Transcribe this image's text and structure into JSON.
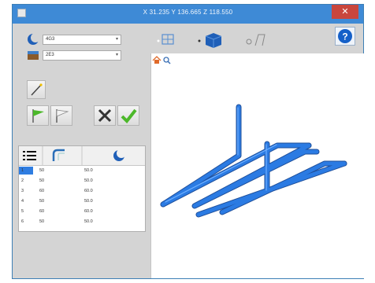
{
  "window": {
    "title": "X 31.235  Y 136.665  Z 118.550",
    "close_glyph": "✕"
  },
  "left_panel": {
    "dropdown1": {
      "value": "4G3"
    },
    "dropdown2": {
      "value": "2E3"
    }
  },
  "grid": {
    "rows": [
      {
        "c1": "1",
        "c2": "50",
        "c3": "50.0"
      },
      {
        "c1": "2",
        "c2": "50",
        "c3": "50.0"
      },
      {
        "c1": "3",
        "c2": "60",
        "c3": "60.0"
      },
      {
        "c1": "4",
        "c2": "50",
        "c3": "50.0"
      },
      {
        "c1": "5",
        "c2": "60",
        "c3": "60.0"
      },
      {
        "c1": "6",
        "c2": "50",
        "c3": "50.0"
      }
    ]
  },
  "colors": {
    "accent": "#3e8ad6",
    "pipe": "#1f6fd1",
    "help": "#1560c8"
  }
}
